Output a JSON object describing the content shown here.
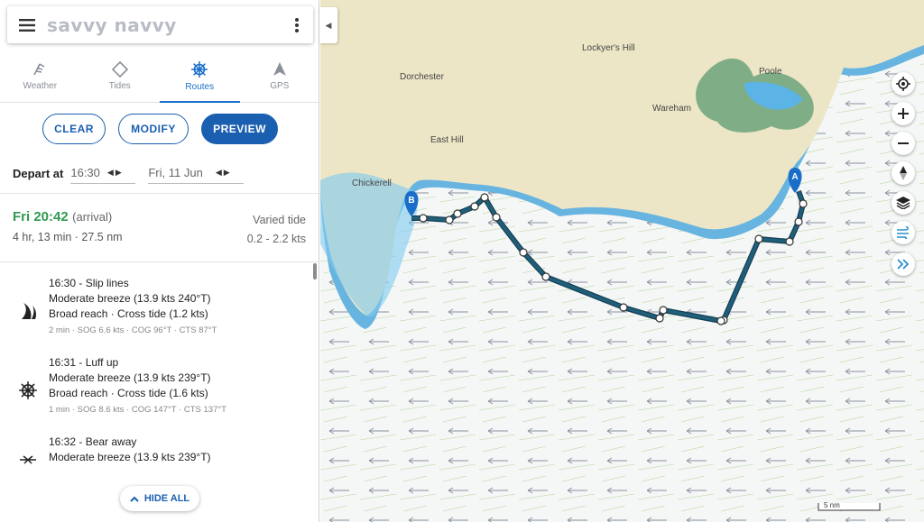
{
  "app": {
    "brand": "savvy navvy"
  },
  "tabs": [
    {
      "label": "Weather",
      "icon": "weather-icon"
    },
    {
      "label": "Tides",
      "icon": "tides-icon"
    },
    {
      "label": "Routes",
      "icon": "helm-icon",
      "active": true
    },
    {
      "label": "GPS",
      "icon": "gps-icon"
    }
  ],
  "actions": {
    "clear": "CLEAR",
    "modify": "MODIFY",
    "preview": "PREVIEW"
  },
  "depart": {
    "label": "Depart at",
    "time": "16:30",
    "date": "Fri, 11 Jun"
  },
  "summary": {
    "arrival_time": "Fri 20:42",
    "arrival_label": "(arrival)",
    "duration": "4 hr, 13 min · 27.5 nm",
    "tide_label": "Varied tide",
    "tide_range": "0.2 - 2.2 kts"
  },
  "steps": [
    {
      "title": "16:30 - Slip lines",
      "wind": "Moderate breeze (13.9 kts 240°T)",
      "sail": "Broad reach · Cross tide (1.2 kts)",
      "meta": "2 min · SOG 6.6 kts · COG 96°T · CTS 87°T",
      "icon": "sail-icon"
    },
    {
      "title": "16:31 - Luff up",
      "wind": "Moderate breeze (13.9 kts 239°T)",
      "sail": "Broad reach · Cross tide (1.6 kts)",
      "meta": "1 min · SOG 8.6 kts · COG 147°T · CTS 137°T",
      "icon": "helm-icon"
    },
    {
      "title": "16:32 - Bear away",
      "wind": "Moderate breeze (13.9 kts 239°T)",
      "sail": "",
      "meta": "",
      "icon": "bear-away-icon"
    }
  ],
  "hide_all": "HIDE ALL",
  "map": {
    "places": [
      "Lockyer's Hill",
      "Dorchester",
      "Poole",
      "Wareham",
      "East Hill",
      "Chickerell"
    ],
    "markers": {
      "start": "A",
      "end": "B"
    },
    "scale": "5 nm"
  },
  "colors": {
    "accent": "#1a5fb0",
    "arrival": "#2e9a4e",
    "route": "#1f5f7a"
  }
}
